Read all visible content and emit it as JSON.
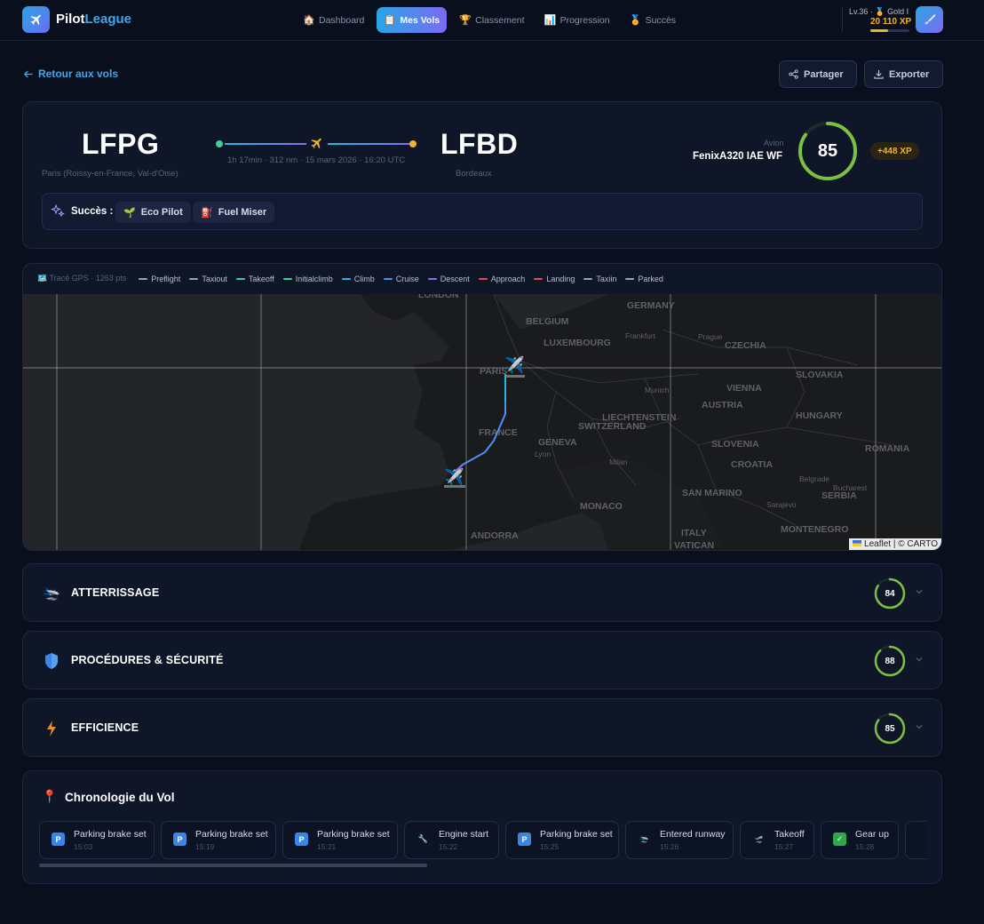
{
  "app": {
    "name_a": "Pilot",
    "name_b": "League"
  },
  "nav": [
    {
      "label": "Dashboard",
      "icon": "house-icon",
      "active": false
    },
    {
      "label": "Mes Vols",
      "icon": "clipboard-icon",
      "active": true
    },
    {
      "label": "Classement",
      "icon": "trophy-icon",
      "active": false
    },
    {
      "label": "Progression",
      "icon": "chart-icon",
      "active": false
    },
    {
      "label": "Succès",
      "icon": "medal-icon",
      "active": false
    }
  ],
  "user": {
    "level": "Lv.36 ·",
    "rank": "Gold I",
    "xp": "20 110 XP",
    "xp_progress": 0.45
  },
  "actions": {
    "back": "Retour aux vols",
    "share": "Partager",
    "export": "Exporter"
  },
  "flight": {
    "origin": {
      "icao": "LFPG",
      "city": "Paris (Roissy-en-France, Val-d'Oise)"
    },
    "destination": {
      "icao": "LFBD",
      "city": "Bordeaux"
    },
    "info": "1h 17min · 312 nm · 15 mars 2026 · 16:20 UTC",
    "aircraft_label": "Avion",
    "aircraft": "FenixA320 IAE WF",
    "score": 85,
    "xp_gain": "+448 XP",
    "achievements_label": "Succès :",
    "achievements": [
      "Eco Pilot",
      "Fuel Miser"
    ]
  },
  "map": {
    "gps_label": "Tracé GPS · 1263 pts",
    "legend": [
      {
        "label": "Preflight",
        "color": "#9aa3b5"
      },
      {
        "label": "Taxiout",
        "color": "#9aa3b5"
      },
      {
        "label": "Takeoff",
        "color": "#3fcf8e"
      },
      {
        "label": "Initialclimb",
        "color": "#3fcf8e"
      },
      {
        "label": "Climb",
        "color": "#22b8e6"
      },
      {
        "label": "Cruise",
        "color": "#4f8ef7"
      },
      {
        "label": "Descent",
        "color": "#8b6cf2"
      },
      {
        "label": "Approach",
        "color": "#e5484d"
      },
      {
        "label": "Landing",
        "color": "#e5484d"
      },
      {
        "label": "Taxiin",
        "color": "#9aa3b5"
      },
      {
        "label": "Parked",
        "color": "#9aa3b5"
      }
    ],
    "labels": [
      "LONDON",
      "BELGIUM",
      "GERMANY",
      "LUXEMBOURG",
      "Frankfurt",
      "Prague",
      "CZECHIA",
      "PARIS",
      "SLOVAKIA",
      "Munich",
      "VIENNA",
      "AUSTRIA",
      "HUNGARY",
      "LIECHTENSTEIN",
      "SWITZERLAND",
      "FRANCE",
      "GENEVA",
      "Lyon",
      "Milan",
      "SLOVENIA",
      "CROATIA",
      "ROMANIA",
      "Belgrade",
      "Bucharest",
      "SAN MARINO",
      "SERBIA",
      "Sarajevo",
      "MONACO",
      "ANDORRA",
      "ITALY",
      "MONTENEGRO",
      "VATICAN"
    ],
    "attribution": "Leaflet | © CARTO"
  },
  "sections": [
    {
      "title": "ATTERRISSAGE",
      "score": 84,
      "icon": "landing-plane-icon"
    },
    {
      "title": "PROCÉDURES & SÉCURITÉ",
      "score": 88,
      "icon": "shield-icon"
    },
    {
      "title": "EFFICIENCE",
      "score": 85,
      "icon": "lightning-icon"
    }
  ],
  "timeline": {
    "title": "Chronologie du Vol",
    "events": [
      {
        "label": "Parking brake set",
        "time": "15:03",
        "icon": "parking-icon"
      },
      {
        "label": "Parking brake set",
        "time": "15:19",
        "icon": "parking-icon"
      },
      {
        "label": "Parking brake set",
        "time": "15:21",
        "icon": "parking-icon"
      },
      {
        "label": "Engine start",
        "time": "15:22",
        "icon": "wrench-icon"
      },
      {
        "label": "Parking brake set",
        "time": "15:25",
        "icon": "parking-icon"
      },
      {
        "label": "Entered runway",
        "time": "15:26",
        "icon": "runway-icon"
      },
      {
        "label": "Takeoff",
        "time": "15:27",
        "icon": "takeoff-icon"
      },
      {
        "label": "Gear up",
        "time": "15:28",
        "icon": "check-icon"
      }
    ]
  },
  "colors": {
    "accent": "#3aa9f0",
    "gold": "#f0b429",
    "score_green": "#7bc043"
  }
}
